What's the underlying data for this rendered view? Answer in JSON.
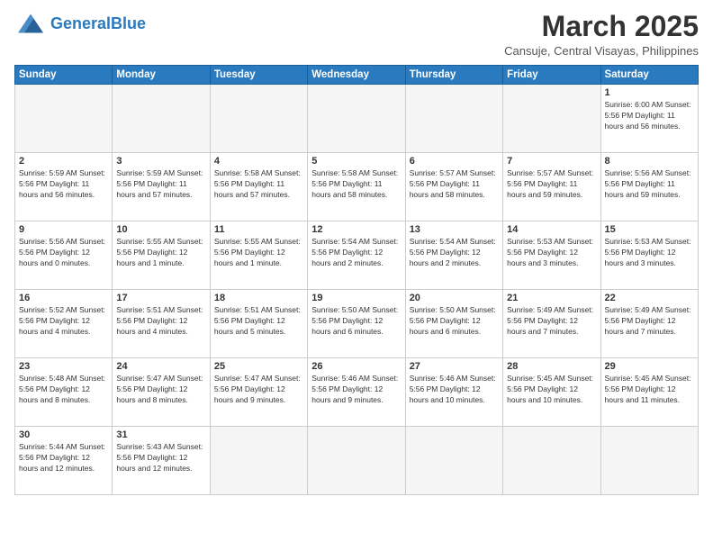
{
  "logo": {
    "text_general": "General",
    "text_blue": "Blue"
  },
  "header": {
    "month_year": "March 2025",
    "location": "Cansuje, Central Visayas, Philippines"
  },
  "days_of_week": [
    "Sunday",
    "Monday",
    "Tuesday",
    "Wednesday",
    "Thursday",
    "Friday",
    "Saturday"
  ],
  "weeks": [
    [
      {
        "day": "",
        "info": "",
        "empty": true
      },
      {
        "day": "",
        "info": "",
        "empty": true
      },
      {
        "day": "",
        "info": "",
        "empty": true
      },
      {
        "day": "",
        "info": "",
        "empty": true
      },
      {
        "day": "",
        "info": "",
        "empty": true
      },
      {
        "day": "",
        "info": "",
        "empty": true
      },
      {
        "day": "1",
        "info": "Sunrise: 6:00 AM\nSunset: 5:56 PM\nDaylight: 11 hours\nand 56 minutes."
      }
    ],
    [
      {
        "day": "2",
        "info": "Sunrise: 5:59 AM\nSunset: 5:56 PM\nDaylight: 11 hours\nand 56 minutes."
      },
      {
        "day": "3",
        "info": "Sunrise: 5:59 AM\nSunset: 5:56 PM\nDaylight: 11 hours\nand 57 minutes."
      },
      {
        "day": "4",
        "info": "Sunrise: 5:58 AM\nSunset: 5:56 PM\nDaylight: 11 hours\nand 57 minutes."
      },
      {
        "day": "5",
        "info": "Sunrise: 5:58 AM\nSunset: 5:56 PM\nDaylight: 11 hours\nand 58 minutes."
      },
      {
        "day": "6",
        "info": "Sunrise: 5:57 AM\nSunset: 5:56 PM\nDaylight: 11 hours\nand 58 minutes."
      },
      {
        "day": "7",
        "info": "Sunrise: 5:57 AM\nSunset: 5:56 PM\nDaylight: 11 hours\nand 59 minutes."
      },
      {
        "day": "8",
        "info": "Sunrise: 5:56 AM\nSunset: 5:56 PM\nDaylight: 11 hours\nand 59 minutes."
      }
    ],
    [
      {
        "day": "9",
        "info": "Sunrise: 5:56 AM\nSunset: 5:56 PM\nDaylight: 12 hours\nand 0 minutes."
      },
      {
        "day": "10",
        "info": "Sunrise: 5:55 AM\nSunset: 5:56 PM\nDaylight: 12 hours\nand 1 minute."
      },
      {
        "day": "11",
        "info": "Sunrise: 5:55 AM\nSunset: 5:56 PM\nDaylight: 12 hours\nand 1 minute."
      },
      {
        "day": "12",
        "info": "Sunrise: 5:54 AM\nSunset: 5:56 PM\nDaylight: 12 hours\nand 2 minutes."
      },
      {
        "day": "13",
        "info": "Sunrise: 5:54 AM\nSunset: 5:56 PM\nDaylight: 12 hours\nand 2 minutes."
      },
      {
        "day": "14",
        "info": "Sunrise: 5:53 AM\nSunset: 5:56 PM\nDaylight: 12 hours\nand 3 minutes."
      },
      {
        "day": "15",
        "info": "Sunrise: 5:53 AM\nSunset: 5:56 PM\nDaylight: 12 hours\nand 3 minutes."
      }
    ],
    [
      {
        "day": "16",
        "info": "Sunrise: 5:52 AM\nSunset: 5:56 PM\nDaylight: 12 hours\nand 4 minutes."
      },
      {
        "day": "17",
        "info": "Sunrise: 5:51 AM\nSunset: 5:56 PM\nDaylight: 12 hours\nand 4 minutes."
      },
      {
        "day": "18",
        "info": "Sunrise: 5:51 AM\nSunset: 5:56 PM\nDaylight: 12 hours\nand 5 minutes."
      },
      {
        "day": "19",
        "info": "Sunrise: 5:50 AM\nSunset: 5:56 PM\nDaylight: 12 hours\nand 6 minutes."
      },
      {
        "day": "20",
        "info": "Sunrise: 5:50 AM\nSunset: 5:56 PM\nDaylight: 12 hours\nand 6 minutes."
      },
      {
        "day": "21",
        "info": "Sunrise: 5:49 AM\nSunset: 5:56 PM\nDaylight: 12 hours\nand 7 minutes."
      },
      {
        "day": "22",
        "info": "Sunrise: 5:49 AM\nSunset: 5:56 PM\nDaylight: 12 hours\nand 7 minutes."
      }
    ],
    [
      {
        "day": "23",
        "info": "Sunrise: 5:48 AM\nSunset: 5:56 PM\nDaylight: 12 hours\nand 8 minutes."
      },
      {
        "day": "24",
        "info": "Sunrise: 5:47 AM\nSunset: 5:56 PM\nDaylight: 12 hours\nand 8 minutes."
      },
      {
        "day": "25",
        "info": "Sunrise: 5:47 AM\nSunset: 5:56 PM\nDaylight: 12 hours\nand 9 minutes."
      },
      {
        "day": "26",
        "info": "Sunrise: 5:46 AM\nSunset: 5:56 PM\nDaylight: 12 hours\nand 9 minutes."
      },
      {
        "day": "27",
        "info": "Sunrise: 5:46 AM\nSunset: 5:56 PM\nDaylight: 12 hours\nand 10 minutes."
      },
      {
        "day": "28",
        "info": "Sunrise: 5:45 AM\nSunset: 5:56 PM\nDaylight: 12 hours\nand 10 minutes."
      },
      {
        "day": "29",
        "info": "Sunrise: 5:45 AM\nSunset: 5:56 PM\nDaylight: 12 hours\nand 11 minutes."
      }
    ],
    [
      {
        "day": "30",
        "info": "Sunrise: 5:44 AM\nSunset: 5:56 PM\nDaylight: 12 hours\nand 12 minutes."
      },
      {
        "day": "31",
        "info": "Sunrise: 5:43 AM\nSunset: 5:56 PM\nDaylight: 12 hours\nand 12 minutes."
      },
      {
        "day": "",
        "info": "",
        "empty": true
      },
      {
        "day": "",
        "info": "",
        "empty": true
      },
      {
        "day": "",
        "info": "",
        "empty": true
      },
      {
        "day": "",
        "info": "",
        "empty": true
      },
      {
        "day": "",
        "info": "",
        "empty": true
      }
    ]
  ]
}
